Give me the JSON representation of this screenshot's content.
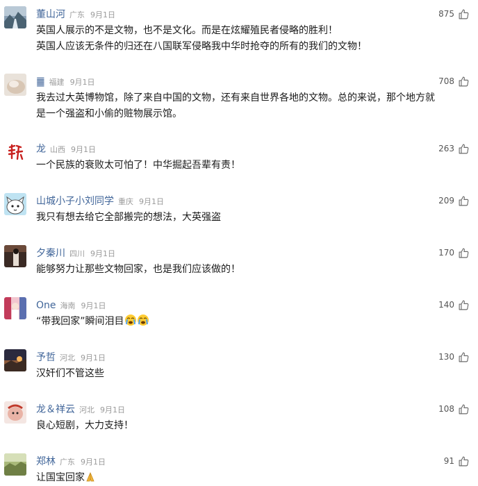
{
  "comments": [
    {
      "name": "董山河",
      "location": "广东",
      "date": "9月1日",
      "likes": "875",
      "lines": [
        "英国人展示的不是文物，也不是文化。而是在炫耀殖民者侵略的胜利！",
        "英国人应该无条件的归还在八国联军侵略我中华时抢夺的所有的我们的文物！"
      ]
    },
    {
      "name": "䷀",
      "location": "福建",
      "date": "9月1日",
      "likes": "708",
      "lines": [
        "我去过大英博物馆，除了来自中国的文物，还有来自世界各地的文物。总的来说，那个地方就",
        "是一个强盗和小偷的赃物展示馆。"
      ]
    },
    {
      "name": "龙",
      "location": "山西",
      "date": "9月1日",
      "likes": "263",
      "lines": [
        "一个民族的衰败太可怕了！中华掘起吾辈有责！"
      ]
    },
    {
      "name": "山城小子小刘同学",
      "location": "重庆",
      "date": "9月1日",
      "likes": "209",
      "lines": [
        "我只有想去给它全部搬完的想法，大英强盗"
      ]
    },
    {
      "name": "夕秦川",
      "location": "四川",
      "date": "9月1日",
      "likes": "170",
      "lines": [
        "能够努力让那些文物回家，也是我们应该做的！"
      ]
    },
    {
      "name": "One",
      "location": "海南",
      "date": "9月1日",
      "likes": "140",
      "lines": [
        "“带我回家”瞬间泪目"
      ]
    },
    {
      "name": "予哲",
      "location": "河北",
      "date": "9月1日",
      "likes": "130",
      "lines": [
        "汉奸们不管这些"
      ]
    },
    {
      "name": "龙＆祥云",
      "location": "河北",
      "date": "9月1日",
      "likes": "108",
      "lines": [
        "良心短剧，大力支持！"
      ]
    },
    {
      "name": "郑林",
      "location": "广东",
      "date": "9月1日",
      "likes": "91",
      "lines": [
        "让国宝回家"
      ]
    }
  ],
  "icons": {
    "like": "thumbs-up-icon",
    "crying": "loudly-crying-face-emoji",
    "pray": "folded-hands-emoji"
  },
  "colors": {
    "name": "#406599",
    "meta": "#9a9a9a",
    "text": "#1a1a1a"
  }
}
